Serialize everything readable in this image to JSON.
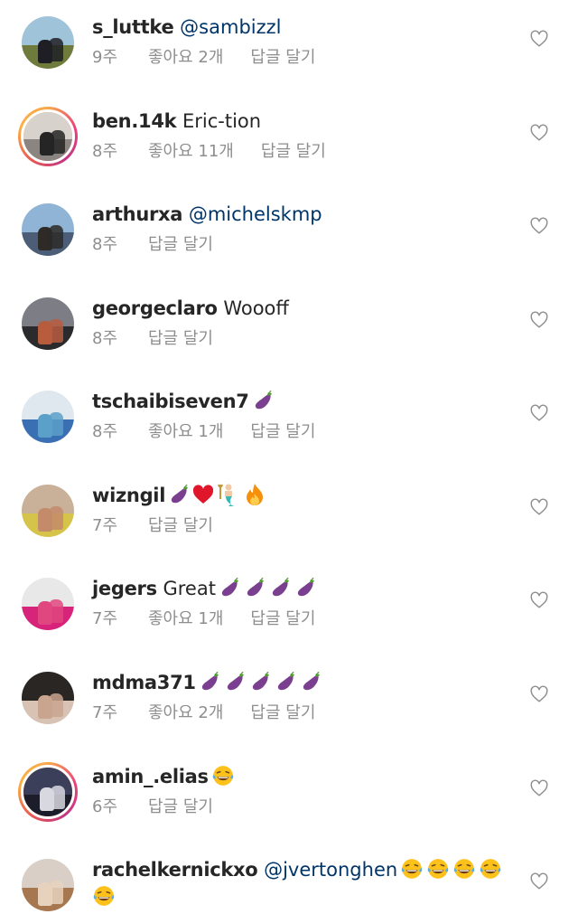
{
  "comments": [
    {
      "username": "s_luttke",
      "text": "",
      "mention": "@sambizzl",
      "time": "9주",
      "likes": "좋아요 2개",
      "reply": "답글 달기",
      "story_ring": false,
      "avatar_colors": {
        "sky": "#9fc3d9",
        "ground": "#6e7b3c",
        "fig": "#1e1e24"
      }
    },
    {
      "username": "ben.14k",
      "text": "Eric-tion",
      "mention": "",
      "time": "8주",
      "likes": "좋아요 11개",
      "reply": "답글 달기",
      "story_ring": true,
      "avatar_colors": {
        "sky": "#d7d3cc",
        "ground": "#8a8580",
        "fig": "#252525"
      }
    },
    {
      "username": "arthurxa",
      "text": "",
      "mention": "@michelskmp",
      "time": "8주",
      "likes": "",
      "reply": "답글 달기",
      "story_ring": false,
      "avatar_colors": {
        "sky": "#8fb4d6",
        "ground": "#4b5d77",
        "fig": "#2d2a28"
      }
    },
    {
      "username": "georgeclaro",
      "text": "Woooff",
      "mention": "",
      "time": "8주",
      "likes": "",
      "reply": "답글 달기",
      "story_ring": false,
      "avatar_colors": {
        "sky": "#7d7d85",
        "ground": "#2b2b2e",
        "fig": "#b85c3e"
      }
    },
    {
      "username": "tschaibiseven7",
      "text": "",
      "mention": "",
      "emoji": [
        "eggplant"
      ],
      "time": "8주",
      "likes": "좋아요 1개",
      "reply": "답글 달기",
      "story_ring": false,
      "avatar_colors": {
        "sky": "#dfe8ee",
        "ground": "#3a6fb3",
        "fig": "#5aa0c8"
      }
    },
    {
      "username": "wizngil",
      "text": "",
      "mention": "",
      "emoji": [
        "eggplant",
        "red-heart",
        "merman",
        "fire"
      ],
      "time": "7주",
      "likes": "",
      "reply": "답글 달기",
      "story_ring": false,
      "avatar_colors": {
        "sky": "#c9b199",
        "ground": "#d6c44a",
        "fig": "#c48b6a"
      }
    },
    {
      "username": "jegers",
      "text": "Great",
      "mention": "",
      "emoji": [
        "eggplant",
        "eggplant",
        "eggplant",
        "eggplant"
      ],
      "time": "7주",
      "likes": "좋아요 1개",
      "reply": "답글 달기",
      "story_ring": false,
      "avatar_colors": {
        "sky": "#e8e8e8",
        "ground": "#d8237a",
        "fig": "#e0467f"
      }
    },
    {
      "username": "mdma371",
      "text": "",
      "mention": "",
      "emoji": [
        "eggplant",
        "eggplant",
        "eggplant",
        "eggplant",
        "eggplant"
      ],
      "time": "7주",
      "likes": "좋아요 2개",
      "reply": "답글 달기",
      "story_ring": false,
      "avatar_colors": {
        "sky": "#2a2624",
        "ground": "#d7c2b4",
        "fig": "#c9a48e"
      }
    },
    {
      "username": "amin_.elias",
      "text": "",
      "mention": "",
      "emoji": [
        "tears-of-joy"
      ],
      "time": "6주",
      "likes": "",
      "reply": "답글 달기",
      "story_ring": true,
      "avatar_colors": {
        "sky": "#3b3f5a",
        "ground": "#1c1d2a",
        "fig": "#d8d8e0"
      }
    },
    {
      "username": "rachelkernickxo",
      "text": "",
      "mention": "@jvertonghen",
      "emoji": [
        "tears-of-joy",
        "tears-of-joy",
        "tears-of-joy",
        "tears-of-joy"
      ],
      "emoji_line2": [
        "tears-of-joy"
      ],
      "time": "",
      "likes": "",
      "reply": "",
      "story_ring": false,
      "avatar_colors": {
        "sky": "#d9cfc6",
        "ground": "#a7774f",
        "fig": "#e6d2bd"
      }
    }
  ],
  "icons": {
    "like": "heart-outline-icon"
  },
  "colors": {
    "username": "#262626",
    "mention": "#003569",
    "meta": "#8e8e8e",
    "heart_stroke": "#8e8e8e"
  }
}
